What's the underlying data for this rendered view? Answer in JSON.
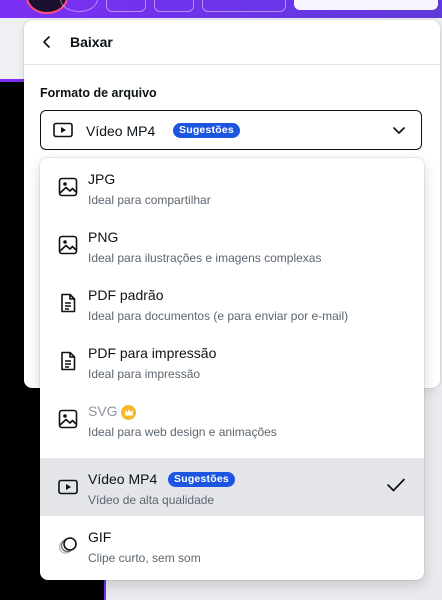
{
  "panel": {
    "title": "Baixar",
    "format_label": "Formato de arquivo",
    "selected_format": "Vídeo MP4",
    "selected_badge": "Sugestões"
  },
  "options": [
    {
      "title": "JPG",
      "desc": "Ideal para compartilhar",
      "icon": "image-icon"
    },
    {
      "title": "PNG",
      "desc": "Ideal para ilustrações e imagens complexas",
      "icon": "image-icon"
    },
    {
      "title": "PDF padrão",
      "desc": "Ideal para documentos (e para enviar por e-mail)",
      "icon": "document-icon"
    },
    {
      "title": "PDF para impressão",
      "desc": "Ideal para impressão",
      "icon": "document-icon"
    },
    {
      "title": "SVG",
      "desc": "Ideal para web design e animações",
      "icon": "image-icon",
      "premium": true
    },
    {
      "title": "Vídeo MP4",
      "desc": "Vídeo de alta qualidade",
      "icon": "video-icon",
      "badge": "Sugestões",
      "selected": true
    },
    {
      "title": "GIF",
      "desc": "Clipe curto, sem som",
      "icon": "gif-icon"
    }
  ],
  "colors": {
    "accent": "#7b2ff2",
    "badge": "#1c55e0",
    "selected_row": "#e3e5e8",
    "crown": "#f6b72a"
  }
}
